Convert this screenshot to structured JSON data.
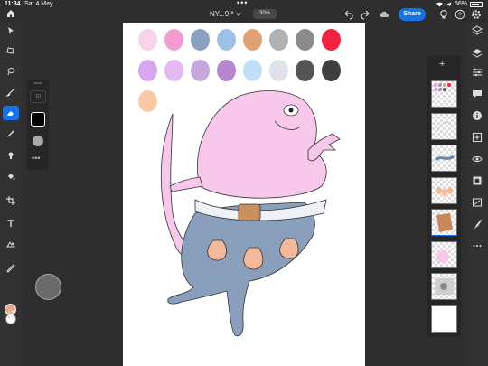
{
  "status": {
    "time": "11:34",
    "date": "Sat 4 May",
    "battery": "66%"
  },
  "document": {
    "name": "NY...9 *",
    "zoom": "30%"
  },
  "share_label": "Share",
  "brush": {
    "size": "10"
  },
  "colors": {
    "accent": "#1473e6",
    "foreground_swatch": "#e8a98a",
    "background_swatch": "#ffffff"
  },
  "palette_swatches": [
    "#f7d4e8",
    "#f39cd3",
    "#8aa2c1",
    "#9fc1e4",
    "#e0a174",
    "#b1b1b1",
    "#8b8b8b",
    "#ef2341",
    "#d8a6ee",
    "#e4b9f1",
    "#c8a6de",
    "#b686d0",
    "#bfe0f8",
    "#dfe2e8",
    "#545454",
    "#3f3f3f",
    "#f8c9a4"
  ],
  "left_tools": [
    "select-icon",
    "transform-icon",
    "lasso-icon",
    "brush-icon",
    "eraser-icon",
    "smudge-icon",
    "clone-icon",
    "fill-icon",
    "crop-icon",
    "text-icon",
    "adjust-icon",
    "eyedropper-icon",
    "swap-colors-icon"
  ],
  "right_tools": [
    "layers-icon",
    "layer-stack-icon",
    "properties-icon",
    "comment-icon",
    "info-icon",
    "add-layer-icon",
    "visibility-icon",
    "mask-icon",
    "effects-icon",
    "more-icon"
  ],
  "layers": [
    {
      "id": "palette-layer",
      "selected": false
    },
    {
      "id": "sketch-layer",
      "selected": false
    },
    {
      "id": "blue-marks-layer",
      "selected": false
    },
    {
      "id": "peach-marks-layer",
      "selected": false
    },
    {
      "id": "brown-shape-layer",
      "selected": true
    },
    {
      "id": "pink-layer",
      "selected": false
    },
    {
      "id": "photo-layer",
      "selected": false
    },
    {
      "id": "white-layer",
      "selected": false
    }
  ]
}
